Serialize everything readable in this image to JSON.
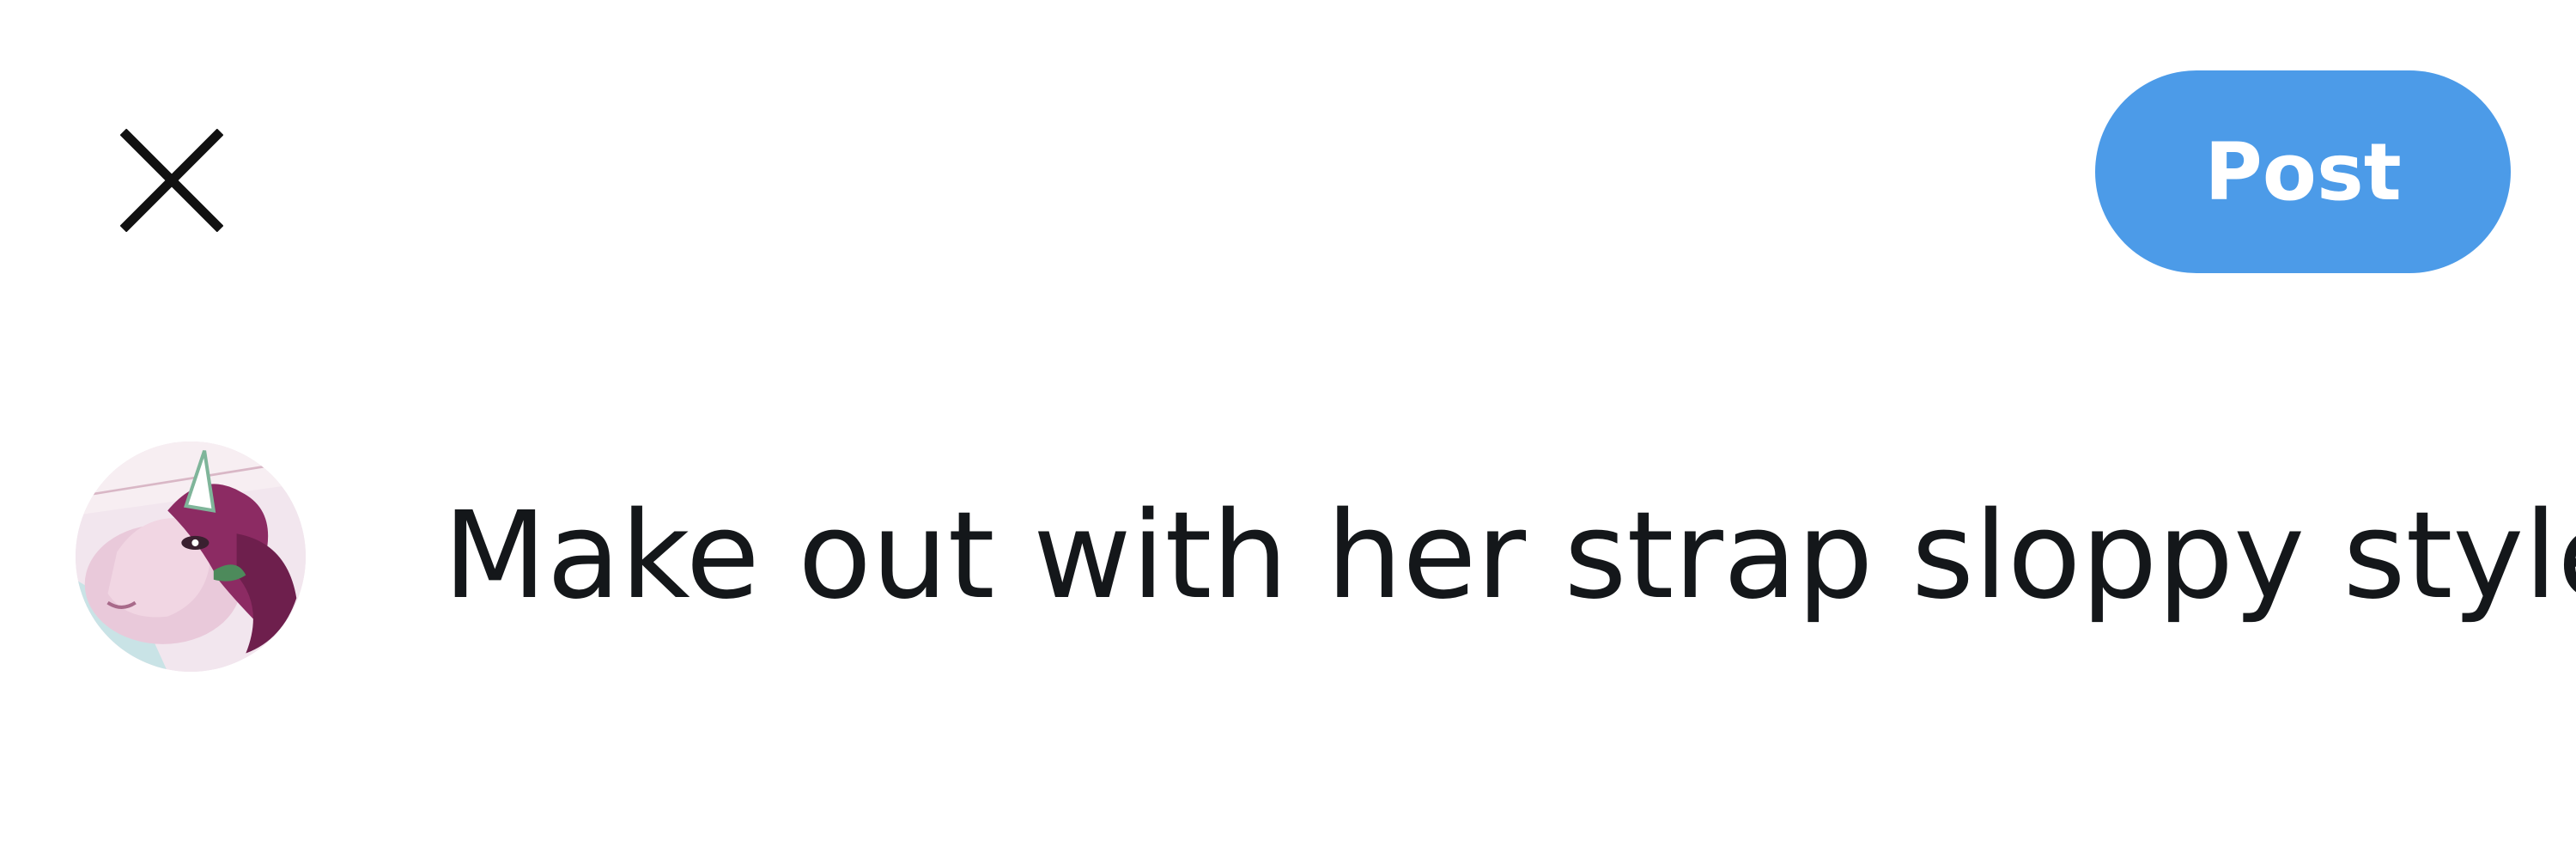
{
  "header": {
    "close_icon": "close-icon",
    "post_label": "Post",
    "post_color": "#4c9be8"
  },
  "composer": {
    "avatar_icon": "unicorn-avatar",
    "text": "Make out with her strap sloppy style",
    "caret_color": "#2f7fe0"
  }
}
